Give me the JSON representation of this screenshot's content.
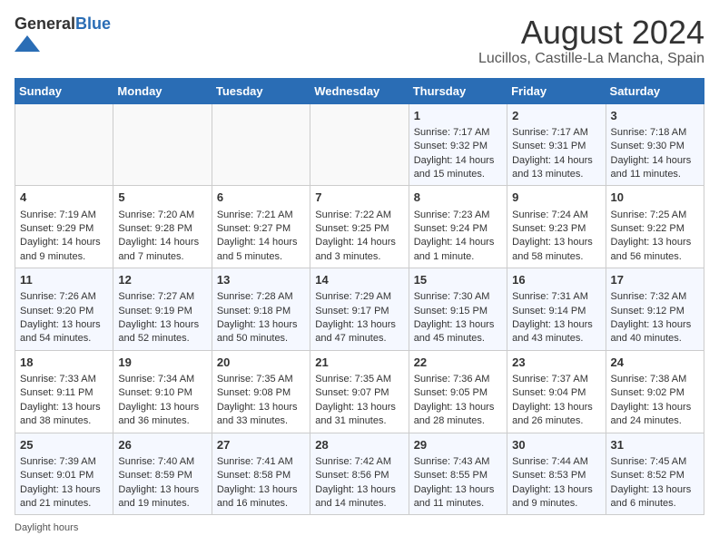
{
  "header": {
    "logo_general": "General",
    "logo_blue": "Blue",
    "title": "August 2024",
    "subtitle": "Lucillos, Castille-La Mancha, Spain"
  },
  "calendar": {
    "days_of_week": [
      "Sunday",
      "Monday",
      "Tuesday",
      "Wednesday",
      "Thursday",
      "Friday",
      "Saturday"
    ],
    "weeks": [
      [
        {
          "day": "",
          "content": ""
        },
        {
          "day": "",
          "content": ""
        },
        {
          "day": "",
          "content": ""
        },
        {
          "day": "",
          "content": ""
        },
        {
          "day": "1",
          "content": "Sunrise: 7:17 AM\nSunset: 9:32 PM\nDaylight: 14 hours and 15 minutes."
        },
        {
          "day": "2",
          "content": "Sunrise: 7:17 AM\nSunset: 9:31 PM\nDaylight: 14 hours and 13 minutes."
        },
        {
          "day": "3",
          "content": "Sunrise: 7:18 AM\nSunset: 9:30 PM\nDaylight: 14 hours and 11 minutes."
        }
      ],
      [
        {
          "day": "4",
          "content": "Sunrise: 7:19 AM\nSunset: 9:29 PM\nDaylight: 14 hours and 9 minutes."
        },
        {
          "day": "5",
          "content": "Sunrise: 7:20 AM\nSunset: 9:28 PM\nDaylight: 14 hours and 7 minutes."
        },
        {
          "day": "6",
          "content": "Sunrise: 7:21 AM\nSunset: 9:27 PM\nDaylight: 14 hours and 5 minutes."
        },
        {
          "day": "7",
          "content": "Sunrise: 7:22 AM\nSunset: 9:25 PM\nDaylight: 14 hours and 3 minutes."
        },
        {
          "day": "8",
          "content": "Sunrise: 7:23 AM\nSunset: 9:24 PM\nDaylight: 14 hours and 1 minute."
        },
        {
          "day": "9",
          "content": "Sunrise: 7:24 AM\nSunset: 9:23 PM\nDaylight: 13 hours and 58 minutes."
        },
        {
          "day": "10",
          "content": "Sunrise: 7:25 AM\nSunset: 9:22 PM\nDaylight: 13 hours and 56 minutes."
        }
      ],
      [
        {
          "day": "11",
          "content": "Sunrise: 7:26 AM\nSunset: 9:20 PM\nDaylight: 13 hours and 54 minutes."
        },
        {
          "day": "12",
          "content": "Sunrise: 7:27 AM\nSunset: 9:19 PM\nDaylight: 13 hours and 52 minutes."
        },
        {
          "day": "13",
          "content": "Sunrise: 7:28 AM\nSunset: 9:18 PM\nDaylight: 13 hours and 50 minutes."
        },
        {
          "day": "14",
          "content": "Sunrise: 7:29 AM\nSunset: 9:17 PM\nDaylight: 13 hours and 47 minutes."
        },
        {
          "day": "15",
          "content": "Sunrise: 7:30 AM\nSunset: 9:15 PM\nDaylight: 13 hours and 45 minutes."
        },
        {
          "day": "16",
          "content": "Sunrise: 7:31 AM\nSunset: 9:14 PM\nDaylight: 13 hours and 43 minutes."
        },
        {
          "day": "17",
          "content": "Sunrise: 7:32 AM\nSunset: 9:12 PM\nDaylight: 13 hours and 40 minutes."
        }
      ],
      [
        {
          "day": "18",
          "content": "Sunrise: 7:33 AM\nSunset: 9:11 PM\nDaylight: 13 hours and 38 minutes."
        },
        {
          "day": "19",
          "content": "Sunrise: 7:34 AM\nSunset: 9:10 PM\nDaylight: 13 hours and 36 minutes."
        },
        {
          "day": "20",
          "content": "Sunrise: 7:35 AM\nSunset: 9:08 PM\nDaylight: 13 hours and 33 minutes."
        },
        {
          "day": "21",
          "content": "Sunrise: 7:35 AM\nSunset: 9:07 PM\nDaylight: 13 hours and 31 minutes."
        },
        {
          "day": "22",
          "content": "Sunrise: 7:36 AM\nSunset: 9:05 PM\nDaylight: 13 hours and 28 minutes."
        },
        {
          "day": "23",
          "content": "Sunrise: 7:37 AM\nSunset: 9:04 PM\nDaylight: 13 hours and 26 minutes."
        },
        {
          "day": "24",
          "content": "Sunrise: 7:38 AM\nSunset: 9:02 PM\nDaylight: 13 hours and 24 minutes."
        }
      ],
      [
        {
          "day": "25",
          "content": "Sunrise: 7:39 AM\nSunset: 9:01 PM\nDaylight: 13 hours and 21 minutes."
        },
        {
          "day": "26",
          "content": "Sunrise: 7:40 AM\nSunset: 8:59 PM\nDaylight: 13 hours and 19 minutes."
        },
        {
          "day": "27",
          "content": "Sunrise: 7:41 AM\nSunset: 8:58 PM\nDaylight: 13 hours and 16 minutes."
        },
        {
          "day": "28",
          "content": "Sunrise: 7:42 AM\nSunset: 8:56 PM\nDaylight: 13 hours and 14 minutes."
        },
        {
          "day": "29",
          "content": "Sunrise: 7:43 AM\nSunset: 8:55 PM\nDaylight: 13 hours and 11 minutes."
        },
        {
          "day": "30",
          "content": "Sunrise: 7:44 AM\nSunset: 8:53 PM\nDaylight: 13 hours and 9 minutes."
        },
        {
          "day": "31",
          "content": "Sunrise: 7:45 AM\nSunset: 8:52 PM\nDaylight: 13 hours and 6 minutes."
        }
      ]
    ]
  },
  "footer": {
    "daylight_label": "Daylight hours"
  }
}
